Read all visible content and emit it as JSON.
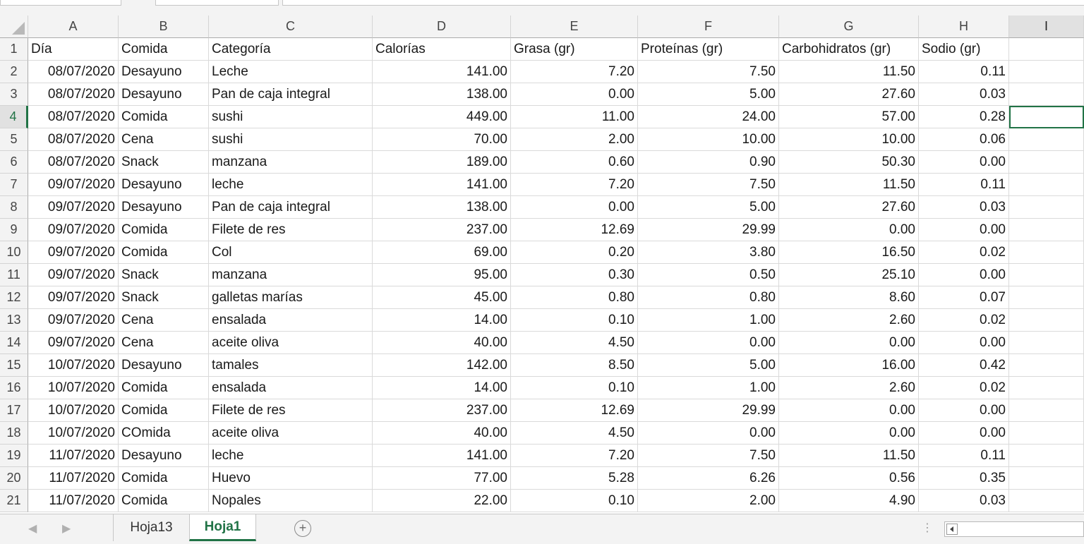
{
  "columns": [
    "A",
    "B",
    "C",
    "D",
    "E",
    "F",
    "G",
    "H",
    "I"
  ],
  "row_numbers": [
    "1",
    "2",
    "3",
    "4",
    "5",
    "6",
    "7",
    "8",
    "9",
    "10",
    "11",
    "12",
    "13",
    "14",
    "15",
    "16",
    "17",
    "18",
    "19",
    "20",
    "21"
  ],
  "header_row": [
    "Día",
    "Comida",
    "Categoría",
    "Calorías",
    "Grasa (gr)",
    "Proteínas (gr)",
    "Carbohidratos (gr)",
    "Sodio (gr)"
  ],
  "rows": [
    [
      "08/07/2020",
      "Desayuno",
      "Leche",
      "141.00",
      "7.20",
      "7.50",
      "11.50",
      "0.11"
    ],
    [
      "08/07/2020",
      "Desayuno",
      "Pan de caja integral",
      "138.00",
      "0.00",
      "5.00",
      "27.60",
      "0.03"
    ],
    [
      "08/07/2020",
      "Comida",
      "sushi",
      "449.00",
      "11.00",
      "24.00",
      "57.00",
      "0.28"
    ],
    [
      "08/07/2020",
      "Cena",
      "sushi",
      "70.00",
      "2.00",
      "10.00",
      "10.00",
      "0.06"
    ],
    [
      "08/07/2020",
      "Snack",
      "manzana",
      "189.00",
      "0.60",
      "0.90",
      "50.30",
      "0.00"
    ],
    [
      "09/07/2020",
      "Desayuno",
      "leche",
      "141.00",
      "7.20",
      "7.50",
      "11.50",
      "0.11"
    ],
    [
      "09/07/2020",
      "Desayuno",
      "Pan de caja integral",
      "138.00",
      "0.00",
      "5.00",
      "27.60",
      "0.03"
    ],
    [
      "09/07/2020",
      "Comida",
      "Filete de res",
      "237.00",
      "12.69",
      "29.99",
      "0.00",
      "0.00"
    ],
    [
      "09/07/2020",
      "Comida",
      "Col",
      "69.00",
      "0.20",
      "3.80",
      "16.50",
      "0.02"
    ],
    [
      "09/07/2020",
      "Snack",
      "manzana",
      "95.00",
      "0.30",
      "0.50",
      "25.10",
      "0.00"
    ],
    [
      "09/07/2020",
      "Snack",
      "galletas marías",
      "45.00",
      "0.80",
      "0.80",
      "8.60",
      "0.07"
    ],
    [
      "09/07/2020",
      "Cena",
      "ensalada",
      "14.00",
      "0.10",
      "1.00",
      "2.60",
      "0.02"
    ],
    [
      "09/07/2020",
      "Cena",
      "aceite oliva",
      "40.00",
      "4.50",
      "0.00",
      "0.00",
      "0.00"
    ],
    [
      "10/07/2020",
      "Desayuno",
      "tamales",
      "142.00",
      "8.50",
      "5.00",
      "16.00",
      "0.42"
    ],
    [
      "10/07/2020",
      "Comida",
      "ensalada",
      "14.00",
      "0.10",
      "1.00",
      "2.60",
      "0.02"
    ],
    [
      "10/07/2020",
      "Comida",
      "Filete de res",
      "237.00",
      "12.69",
      "29.99",
      "0.00",
      "0.00"
    ],
    [
      "10/07/2020",
      "COmida",
      "aceite oliva",
      "40.00",
      "4.50",
      "0.00",
      "0.00",
      "0.00"
    ],
    [
      "11/07/2020",
      "Desayuno",
      "leche",
      "141.00",
      "7.20",
      "7.50",
      "11.50",
      "0.11"
    ],
    [
      "11/07/2020",
      "Comida",
      "Huevo",
      "77.00",
      "5.28",
      "6.26",
      "0.56",
      "0.35"
    ],
    [
      "11/07/2020",
      "Comida",
      "Nopales",
      "22.00",
      "0.10",
      "2.00",
      "4.90",
      "0.03"
    ]
  ],
  "selected_cell": {
    "column": "I",
    "row": "4"
  },
  "sheet_tabs": [
    {
      "label": "Hoja13",
      "active": false
    },
    {
      "label": "Hoja1",
      "active": true
    }
  ],
  "add_sheet_symbol": "+",
  "nav": {
    "prev": "◀",
    "next": "▶"
  },
  "more_symbol": "⋮",
  "colors": {
    "accent": "#217346",
    "header_bg": "#f3f3f3",
    "gridline": "#dadada"
  }
}
